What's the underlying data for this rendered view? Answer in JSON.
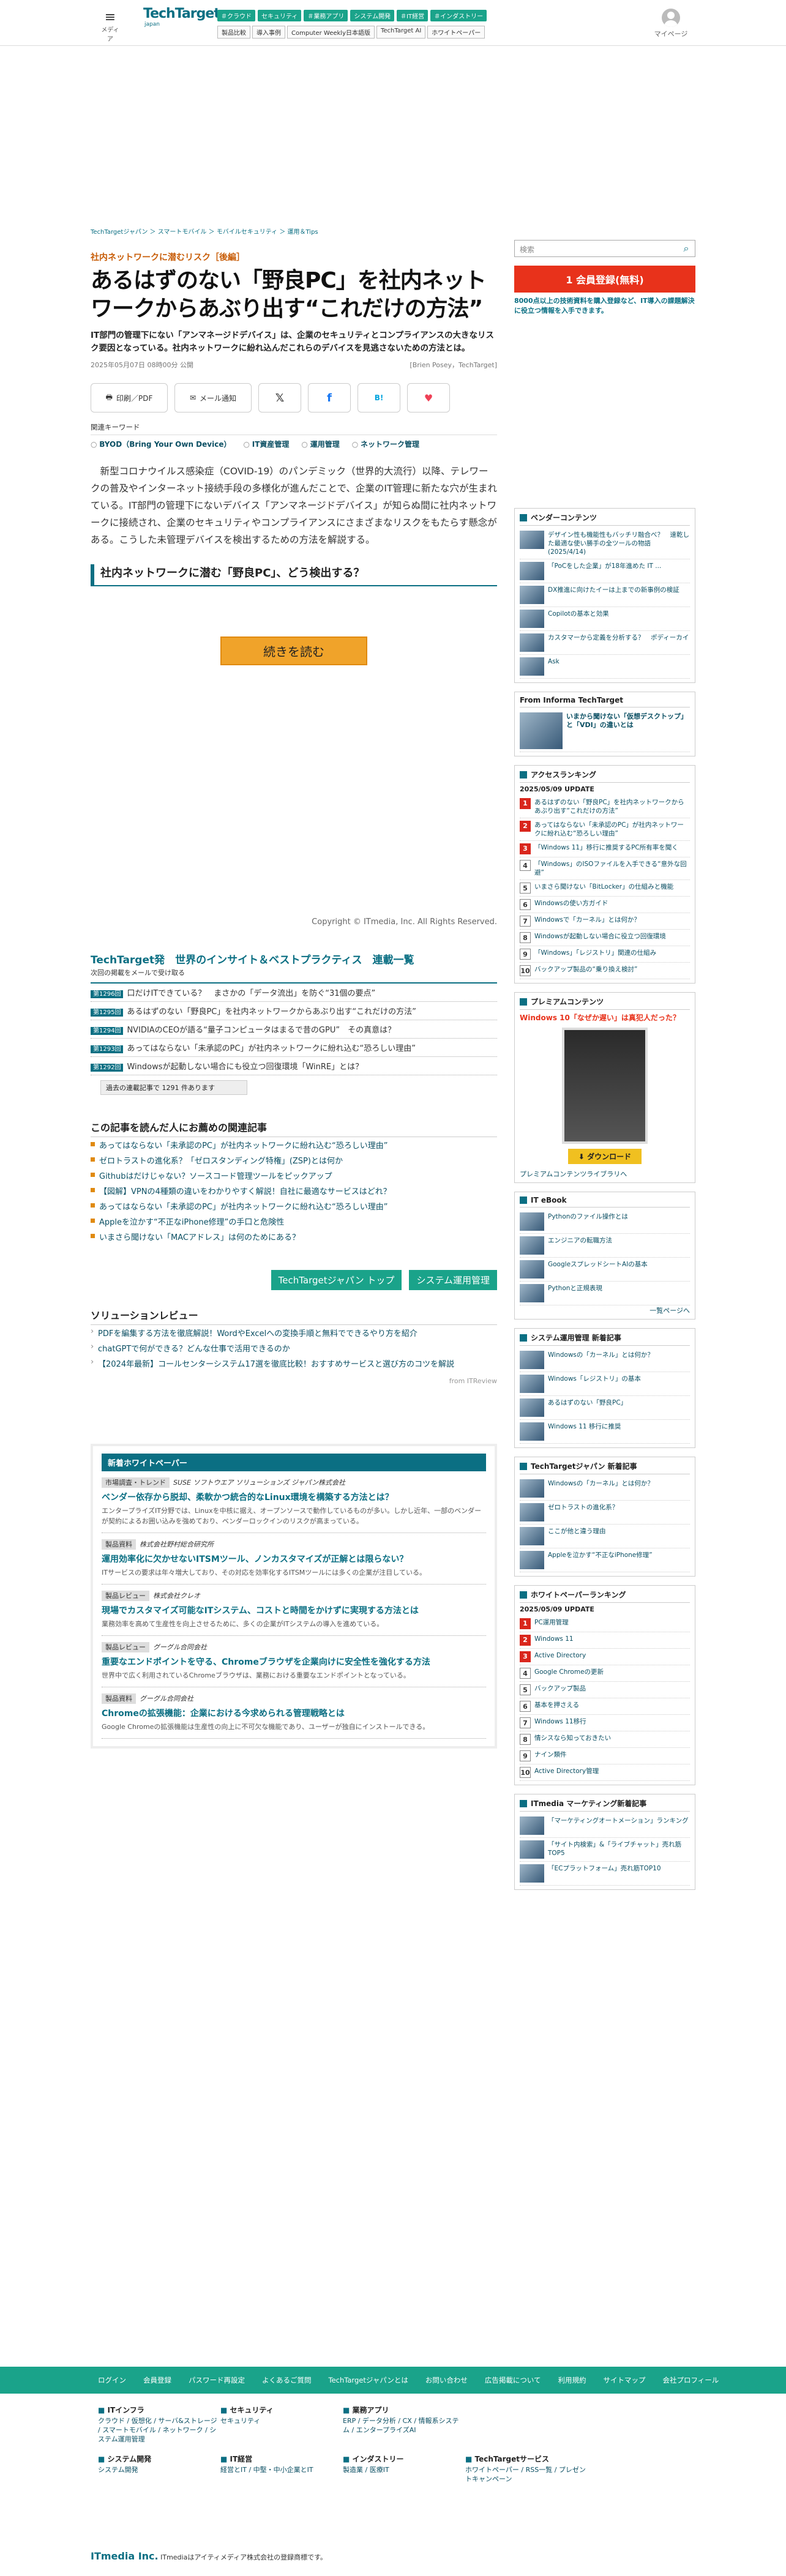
{
  "header": {
    "menu_label": "メディア",
    "logo": "TechTarget",
    "logo_sub": "japan",
    "mypage": "マイページ",
    "tags": [
      "＃クラウド",
      "セキュリティ",
      "＃業務アプリ",
      "システム開発",
      "＃IT経営",
      "＃インダストリー"
    ],
    "nav": [
      "製品比較",
      "導入事例",
      "Computer Weekly日本語版",
      "TechTarget AI",
      "ホワイトペーパー"
    ]
  },
  "breadcrumb": "TechTargetジャパン ＞ スマートモバイル ＞ モバイルセキュリティ ＞ 運用＆Tips",
  "article": {
    "kicker": "社内ネットワークに潜むリスク［後編］",
    "title": "あるはずのない「野良PC」を社内ネットワークからあぶり出す“これだけの方法”",
    "lede": "IT部門の管理下にない「アンマネージドデバイス」は、企業のセキュリティとコンプライアンスの大きなリスク要因となっている。社内ネットワークに紛れ込んだこれらのデバイスを見逃さないための方法とは。",
    "date": "2025年05月07日 08時00分 公開",
    "author": "[Brien Posey，TechTarget]",
    "share": {
      "print": "印刷／PDF",
      "mail": "メール通知"
    },
    "keywords_heading": "関連キーワード",
    "keywords": [
      "BYOD（Bring Your Own Device）",
      "IT資産管理",
      "運用管理",
      "ネットワーク管理"
    ],
    "body": "新型コロナウイルス感染症（COVID-19）のパンデミック（世界的大流行）以降、テレワークの普及やインターネット接続手段の多様化が進んだことで、企業のIT管理に新たな穴が生まれている。IT部門の管理下にないデバイス「アンマネージドデバイス」が知らぬ間に社内ネットワークに接続され、企業のセキュリティやコンプライアンスにさまざまなリスクをもたらす懸念がある。こうした未管理デバイスを検出するための方法を解説する。",
    "section": "社内ネットワークに潜む「野良PC」、どう検出する？",
    "readmore": "続きを読む",
    "copyright": "Copyright © ITmedia, Inc. All Rights Reserved."
  },
  "ranking": {
    "title": "TechTarget発　世界のインサイト＆ベストプラクティス　連載一覧",
    "sub": "次回の掲載をメールで受け取る",
    "items": [
      {
        "no": "第1296回",
        "t": "口だけITできている？　まさかの「データ流出」を防ぐ“31個の要点”"
      },
      {
        "no": "第1295回",
        "t": "あるはずのない「野良PC」を社内ネットワークからあぶり出す“これだけの方法”"
      },
      {
        "no": "第1294回",
        "t": "NVIDIAのCEOが語る“量子コンピュータはまるで昔のGPU”　その真意は？"
      },
      {
        "no": "第1293回",
        "t": "あってはならない「未承認のPC」が社内ネットワークに紛れ込む“恐ろしい理由”"
      },
      {
        "no": "第1292回",
        "t": "Windowsが起動しない場合にも役立つ回復環境「WinRE」とは？"
      }
    ],
    "more": "過去の連載記事で 1291 件あります"
  },
  "related": {
    "heading": "この記事を読んだ人にお薦めの関連記事",
    "items": [
      "あってはならない「未承認のPC」が社内ネットワークに紛れ込む“恐ろしい理由”",
      "ゼロトラストの進化系？「ゼロスタンディング特権」(ZSP)とは何か",
      "Githubはだけじゃない？ソースコード管理ツールをピックアップ",
      "【図解】VPNの4種類の違いをわかりやすく解説！自社に最適なサービスはどれ？",
      "あってはならない「未承認のPC」が社内ネットワークに紛れ込む“恐ろしい理由”",
      "Appleを泣かす“不正なiPhone修理”の手口と危険性",
      "いまさら聞けない「MACアドレス」は何のためにある？"
    ]
  },
  "buttons": {
    "top": "TechTargetジャパン トップ",
    "ops": "システム運用管理"
  },
  "solution": {
    "heading": "ソリューションレビュー",
    "items": [
      "PDFを編集する方法を徹底解説！WordやExcelへの変換手順と無料でできるやり方を紹介",
      "chatGPTで何ができる？どんな仕事で活用できるのか",
      "【2024年最新】コールセンターシステム17選を徹底比較！おすすめサービスと選び方のコツを解説"
    ],
    "from": "from ITReview"
  },
  "whitepaper": {
    "heading": "新着ホワイトペーパー",
    "items": [
      {
        "cat": "市場調査・トレンド",
        "co": "SUSE ソフトウエア ソリューションズ ジャパン株式会社",
        "t": "ベンダー依存から脱却、柔軟かつ統合的なLinux環境を構築する方法とは？",
        "d": "エンタープライズIT分野では、Linuxを中核に据え、オープンソースで動作しているものが多い。しかし近年、一部のベンダーが契約によるお囲い込みを強めており、ベンダーロックインのリスクが高まっている。"
      },
      {
        "cat": "製品資料",
        "co": "株式会社野村総合研究所",
        "t": "運用効率化に欠かせないITSMツール、ノンカスタマイズが正解とは限らない？",
        "d": "ITサービスの要求は年々増大しており、その対応を効率化するITSMツールには多くの企業が注目している。"
      },
      {
        "cat": "製品レビュー",
        "co": "株式会社クレオ",
        "t": "現場でカスタマイズ可能なITシステム、コストと時間をかけずに実現する方法とは",
        "d": "業務効率を高めて生産性を向上させるために、多くの企業がITシステムの導入を進めている。"
      },
      {
        "cat": "製品レビュー",
        "co": "グーグル合同会社",
        "t": "重要なエンドポイントを守る、Chromeブラウザを企業向けに安全性を強化する方法",
        "d": "世界中で広く利用されているChromeブラウザは、業務における重要なエンドポイントとなっている。"
      },
      {
        "cat": "製品資料",
        "co": "グーグル合同会社",
        "t": "Chromeの拡張機能：企業における今求められる管理戦略とは",
        "d": "Google Chromeの拡張機能は生産性の向上に不可欠な機能であり、ユーザーが独自にインストールできる。"
      }
    ]
  },
  "sidebar": {
    "search_placeholder": "検索",
    "register": "会員登録(無料)",
    "register_note": "8000点以上の技術資料を購入登録など、IT導入の課題解決に役立つ情報を入手できます。",
    "vendor_heading": "ベンダーコンテンツ",
    "vendor": [
      "デザイン性も機能性もバッチリ融合べ？　速乾した最適な使い勝手の全ツールの物語 (2025/4/14)",
      "「PoCをした企業」が18年進めた IT ...",
      "DX推進に向けたイーは上までの新事例の検証",
      "Copilotの基本と効果",
      "カスタマーから定義を分析する？　ポディーカイ",
      "Ask"
    ],
    "informa_heading": "From Informa TechTarget",
    "informa": "いまから聞けない「仮想デスクトップ」と「VDI」の違いとは",
    "access_heading": "アクセスランキング",
    "access_update": "2025/05/09 UPDATE",
    "access": [
      "あるはずのない「野良PC」を社内ネットワークからあぶり出す“これだけの方法”",
      "あってはならない「未承認のPC」が社内ネットワークに紛れ込む“恐ろしい理由”",
      "「Windows 11」移行に推奨するPC所有率を聞く",
      "「Windows」のISOファイルを入手できる“意外な回避”",
      "いまさら聞けない「BitLocker」の仕組みと機能",
      "Windowsの使い方ガイド",
      "Windowsで「カーネル」とは何か？",
      "Windowsが起動しない場合に役立つ回復環境",
      "「Windows」「レジストリ」関連の仕組み",
      "バックアップ製品の“乗り換え検討”"
    ],
    "premium_heading": "プレミアムコンテンツ",
    "premium_title": "Windows 10「なぜか遅い」は真犯人だった？",
    "premium_dl": "ダウンロード",
    "premium_link": "プレミアムコンテンツライブラリへ",
    "ebook_heading": "IT eBook",
    "ebook": [
      "Pythonのファイル操作とは",
      "エンジニアの転職方法",
      "GoogleスプレッドシートAIの基本",
      "Pythonと正規表現"
    ],
    "ebook_more": "一覧ページへ",
    "ops_heading": "システム運用管理 新着記事",
    "ops": [
      "Windowsの「カーネル」とは何か？",
      "Windows「レジストリ」の基本",
      "あるはずのない「野良PC」",
      "Windows 11 移行に推奨"
    ],
    "ttj_heading": "TechTargetジャパン 新着記事",
    "ttj": [
      "Windowsの「カーネル」とは何か？",
      "ゼロトラストの進化系？",
      "ここが他と違う理由",
      "Appleを泣かす“不正なiPhone修理”"
    ],
    "wp_heading": "ホワイトペーパーランキング",
    "wp_update": "2025/05/09 UPDATE",
    "wp": [
      "PC運用管理",
      "Windows 11",
      "Active Directory",
      "Google Chromeの更新",
      "バックアップ製品",
      "基本を押さえる",
      "Windows 11移行",
      "情シスなら知っておきたい",
      "ナイン類件",
      "Active Directory管理"
    ],
    "itmedia_heading": "ITmedia マーケティング新着記事",
    "itmedia": [
      "「マーケティングオートメーション」ランキング",
      "「サイト内検索」&「ライブチャット」売れ筋TOP5",
      "「ECプラットフォーム」売れ筋TOP10"
    ]
  },
  "footer": {
    "nav": [
      "ログイン",
      "会員登録",
      "パスワード再設定",
      "よくあるご質問",
      "TechTargetジャパンとは",
      "お問い合わせ",
      "広告掲載について",
      "利用規約",
      "サイトマップ",
      "会社プロフィール"
    ],
    "cols": [
      {
        "h": "ITインフラ",
        "p": "クラウド / 仮想化 / サーバ&ストレージ / スマートモバイル / ネットワーク / システム運用管理"
      },
      {
        "h": "セキュリティ",
        "p": "セキュリティ"
      },
      {
        "h": "業務アプリ",
        "p": "ERP / データ分析 / CX / 情報系システム / エンタープライズAI"
      },
      {
        "h": "",
        "p": ""
      },
      {
        "h": "システム開発",
        "p": "システム開発"
      },
      {
        "h": "IT経営",
        "p": "経営とIT / 中堅・中小企業とIT"
      },
      {
        "h": "インダストリー",
        "p": "製造業 / 医療IT"
      },
      {
        "h": "TechTargetサービス",
        "p": "ホワイトペーパー / RSS一覧 / プレゼントキャンペーン"
      }
    ],
    "company": "ITmedia Inc.",
    "copy": "ITmediaはアイティメディア株式会社の登録商標です。"
  }
}
